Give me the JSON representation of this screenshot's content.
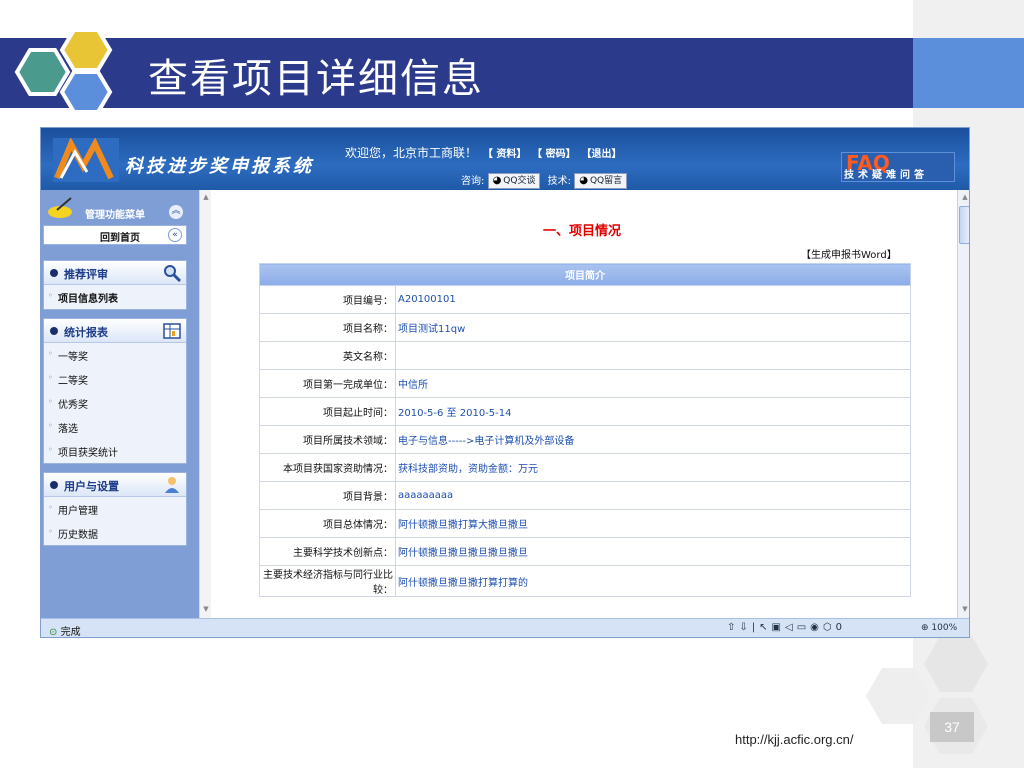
{
  "slide": {
    "title": "查看项目详细信息",
    "url": "http://kjj.acfic.org.cn/",
    "page_number": "37"
  },
  "header": {
    "system_name": "科技进步奖申报系统",
    "welcome": "欢迎您，北京市工商联！",
    "links": [
      "【 资料】",
      "【 密码】",
      "【退出】"
    ],
    "consult_label": "咨询:",
    "qq_chat": "QQ交谈",
    "tech_label": "技术:",
    "qq_message": "QQ留言",
    "faq_big": "FAQ",
    "faq_sub": "技术疑难问答"
  },
  "sidebar": {
    "menu_title": "管理功能菜单",
    "home": "回到首页",
    "groups": [
      {
        "title": "推荐评审",
        "items": [
          "项目信息列表"
        ]
      },
      {
        "title": "统计报表",
        "items": [
          "一等奖",
          "二等奖",
          "优秀奖",
          "落选",
          "项目获奖统计"
        ]
      },
      {
        "title": "用户与设置",
        "items": [
          "用户管理",
          "历史数据"
        ]
      }
    ]
  },
  "content": {
    "section_title": "一、项目情况",
    "generate_word": "【生成申报书Word】",
    "table_header": "项目简介",
    "rows": [
      {
        "key": "项目编号：",
        "value": "A20100101"
      },
      {
        "key": "项目名称：",
        "value": "项目测试11qw"
      },
      {
        "key": "英文名称：",
        "value": ""
      },
      {
        "key": "项目第一完成单位：",
        "value": "中信所"
      },
      {
        "key": "项目起止时间：",
        "value": "2010-5-6 至 2010-5-14"
      },
      {
        "key": "项目所属技术领域：",
        "value": "电子与信息----->电子计算机及外部设备"
      },
      {
        "key": "本项目获国家资助情况：",
        "value": "获科技部资助，资助金额：万元"
      },
      {
        "key": "项目背景：",
        "value": "aaaaaaaaa"
      },
      {
        "key": "项目总体情况：",
        "value": "阿什顿撒旦撒打算大撒旦撒旦"
      },
      {
        "key": "主要科学技术创新点：",
        "value": "阿什顿撒旦撒旦撒旦撒旦撒旦"
      },
      {
        "key": "主要技术经济指标与同行业比较：",
        "value": "阿什顿撒旦撒旦撒打算打算的"
      }
    ]
  },
  "statusbar": {
    "status": "完成",
    "zoom": "100%",
    "counter": "0"
  },
  "colors": {
    "title_band": "#2b3a8b",
    "header_blue": "#1f5aa8",
    "sidebar_blue": "#7f9ed6",
    "section_red": "#e00000",
    "value_blue": "#1e4fb0"
  }
}
